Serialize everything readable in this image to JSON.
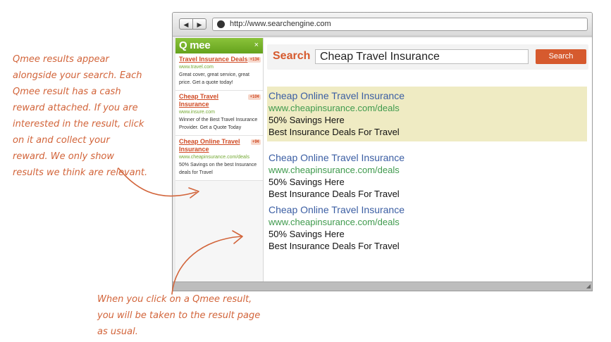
{
  "annotations": {
    "left_lines": [
      "Qmee results appear",
      "alongside your search. Each",
      "Qmee result has a cash",
      "reward attached. If you are",
      "interested in the result, click",
      "on it and collect your",
      "reward. We only show",
      "results we think are relevant."
    ],
    "bottom_lines": [
      "When you click on a Qmee result,",
      "you will be taken to the result page",
      "as usual."
    ]
  },
  "browser": {
    "back_icon": "back-arrow-icon",
    "forward_icon": "forward-arrow-icon",
    "url": "http://www.searchengine.com"
  },
  "qmee": {
    "logo": "Qmee",
    "close": "×",
    "results": [
      {
        "title": "Travel Insurance Deals",
        "badge": "+13¢",
        "url": "www.travel.com",
        "description": "Great cover, great service, great price. Get a quote today!"
      },
      {
        "title": "Cheap Travel Insurance",
        "badge": "+10¢",
        "url": "www.insure.com",
        "description": "Winner of the Best Travel Insurance Provider. Get a Quote Today"
      },
      {
        "title": "Cheap Online Travel Insurance",
        "badge": "+9¢",
        "url": "www.cheapinsurance.com/deals",
        "description": "50% Savings on the best Insurance deals for Travel"
      }
    ]
  },
  "search": {
    "label": "Search",
    "query": "Cheap Travel Insurance",
    "button": "Search"
  },
  "results": [
    {
      "title": "Cheap Online Travel Insurance",
      "url": "www.cheapinsurance.com/deals",
      "line1": "50% Savings Here",
      "line2": "Best Insurance Deals For Travel"
    },
    {
      "title": "Cheap Online Travel Insurance",
      "url": "www.cheapinsurance.com/deals",
      "line1": "50% Savings Here",
      "line2": "Best Insurance Deals For Travel"
    },
    {
      "title": "Cheap Online Travel Insurance",
      "url": "www.cheapinsurance.com/deals",
      "line1": "50% Savings Here",
      "line2": "Best Insurance Deals For Travel"
    }
  ],
  "colors": {
    "accent": "#d65a2e",
    "qmee_green": "#76b32b",
    "link_blue": "#3b5ea3",
    "url_green": "#3f9a4d",
    "highlight": "#efebc3"
  }
}
